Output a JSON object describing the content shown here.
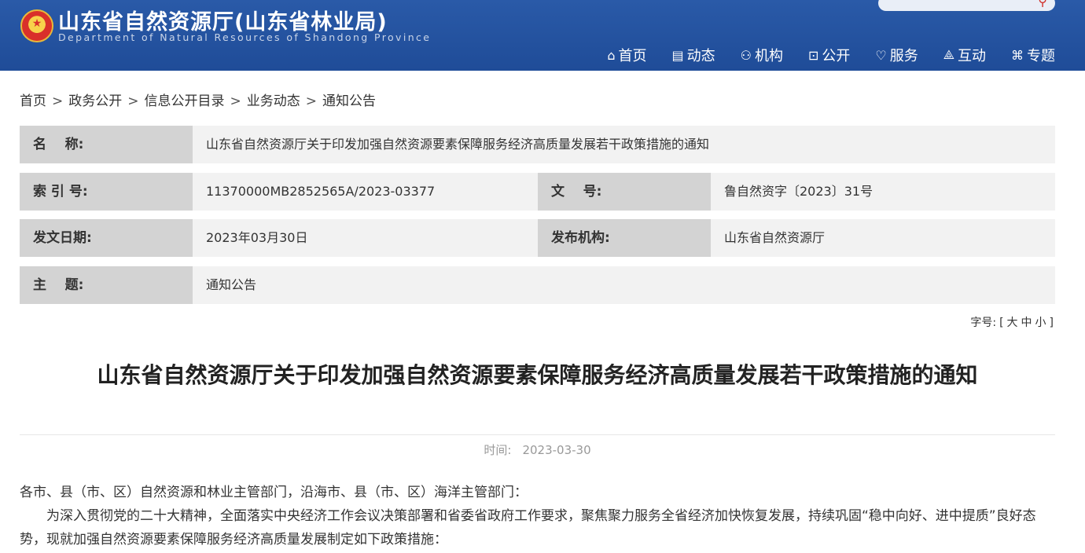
{
  "header": {
    "site_title": "山东省自然资源厅(山东省林业局)",
    "site_subtitle": "Department of Natural Resources of Shandong Province",
    "brand_color": "#2552a0",
    "search_icon": "search-icon"
  },
  "nav": [
    {
      "label": "首页",
      "icon": "home-icon"
    },
    {
      "label": "动态",
      "icon": "news-icon"
    },
    {
      "label": "机构",
      "icon": "org-icon"
    },
    {
      "label": "公开",
      "icon": "lock-icon"
    },
    {
      "label": "服务",
      "icon": "heart-icon"
    },
    {
      "label": "互动",
      "icon": "interact-icon"
    },
    {
      "label": "专题",
      "icon": "grid-icon"
    }
  ],
  "breadcrumb": [
    "首页",
    "政务公开",
    "信息公开目录",
    "业务动态",
    "通知公告"
  ],
  "breadcrumb_sep": ">",
  "meta": {
    "name_label": "名    称:",
    "name_value": "山东省自然资源厅关于印发加强自然资源要素保障服务经济高质量发展若干政策措施的通知",
    "index_label": "索 引 号:",
    "index_value": "11370000MB2852565A/2023-03377",
    "doc_no_label": "文    号:",
    "doc_no_value": "鲁自然资字〔2023〕31号",
    "date_label": "发文日期:",
    "date_value": "2023年03月30日",
    "org_label": "发布机构:",
    "org_value": "山东省自然资源厅",
    "topic_label": "主    题:",
    "topic_value": "通知公告"
  },
  "font_size": {
    "label": "字号:",
    "open": "[",
    "large": "大",
    "medium": "中",
    "small": "小",
    "close": "]"
  },
  "article": {
    "title": "山东省自然资源厅关于印发加强自然资源要素保障服务经济高质量发展若干政策措施的通知",
    "time_label": "时间:",
    "time_value": "2023-03-30",
    "paragraphs": [
      "各市、县（市、区）自然资源和林业主管部门，沿海市、县（市、区）海洋主管部门：",
      "为深入贯彻党的二十大精神，全面落实中央经济工作会议决策部署和省委省政府工作要求，聚焦聚力服务全省经济加快恢复发展，持续巩固“稳中向好、进中提质”良好态势，现就加强自然资源要素保障服务经济高质量发展制定如下政策措施："
    ]
  }
}
